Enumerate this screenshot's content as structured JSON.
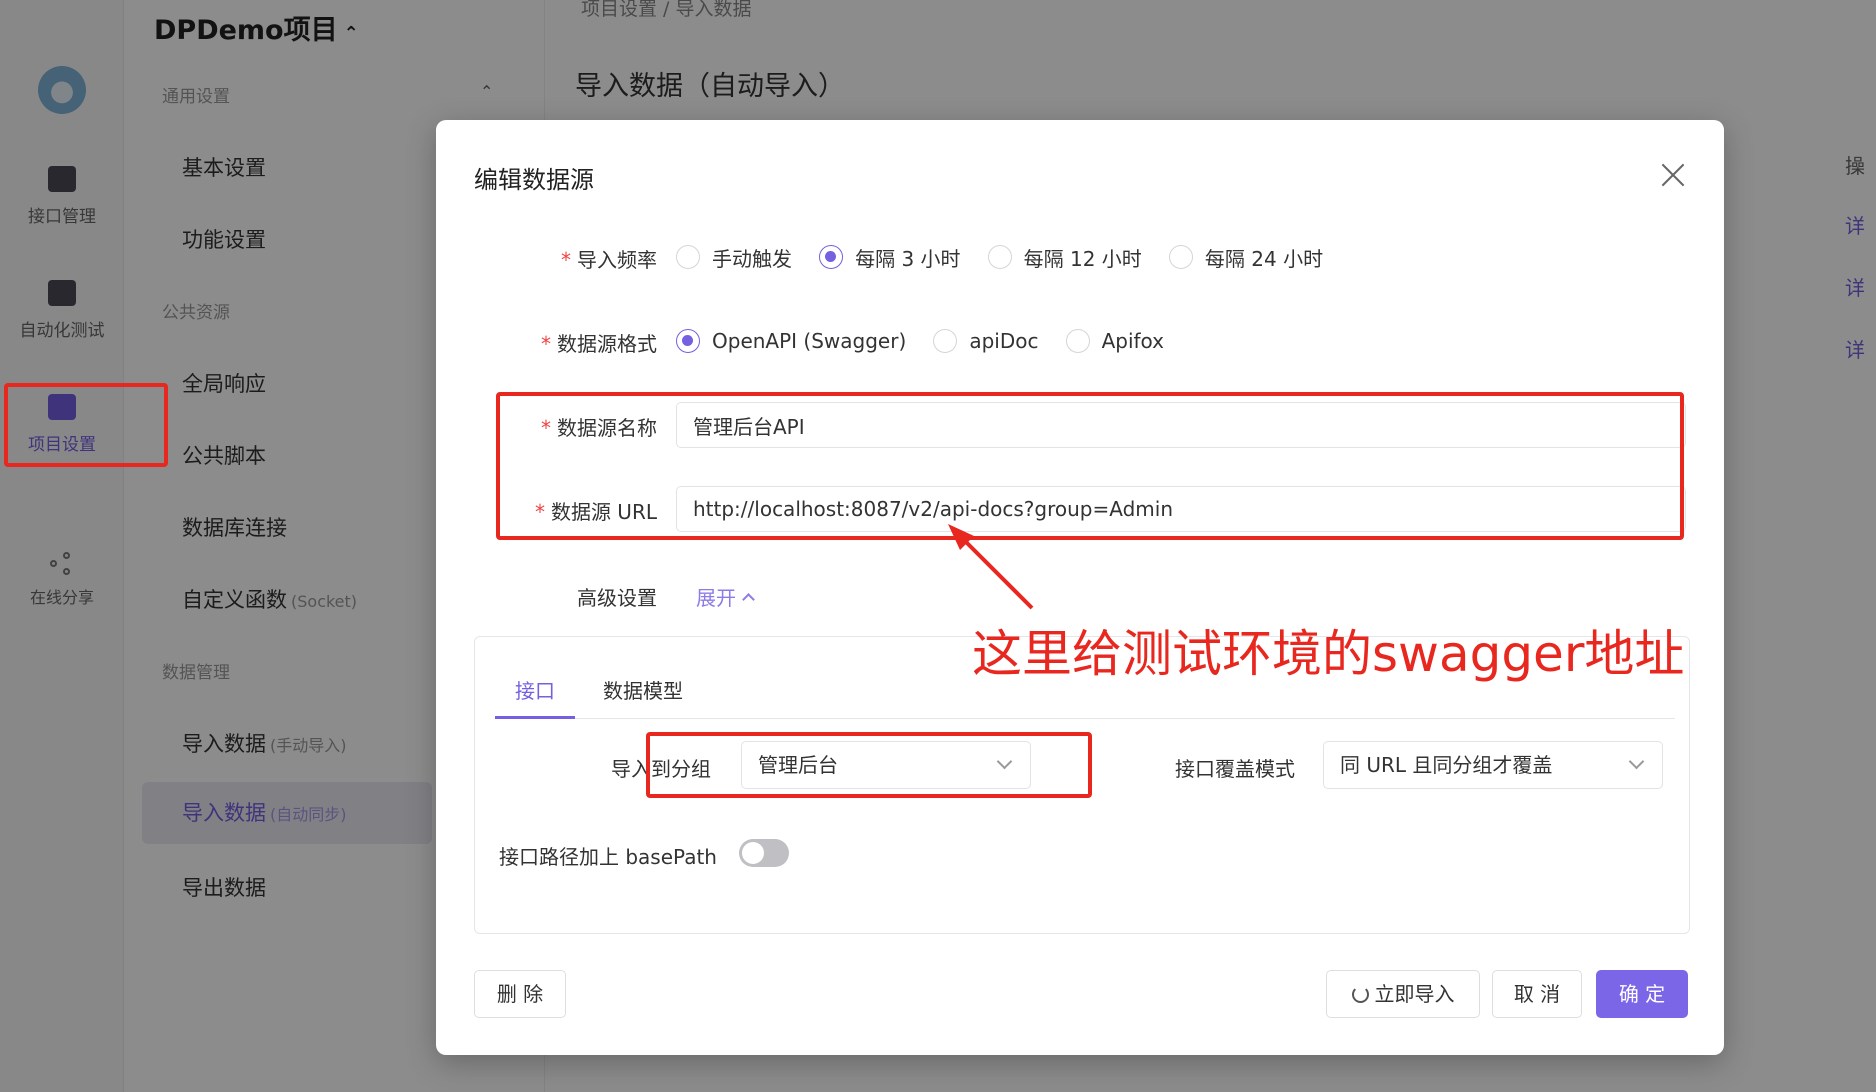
{
  "rail": {
    "items": [
      {
        "label": "接口管理",
        "icon": "api-icon"
      },
      {
        "label": "自动化测试",
        "icon": "automation-icon"
      },
      {
        "label": "项目设置",
        "icon": "project-settings-icon"
      },
      {
        "label": "在线分享",
        "icon": "share-icon"
      }
    ]
  },
  "sidebar": {
    "project_title": "DPDemo项目",
    "groups": [
      {
        "label": "通用设置"
      },
      {
        "label": "公共资源"
      },
      {
        "label": "数据管理"
      }
    ],
    "items": [
      {
        "label": "基本设置",
        "note": ""
      },
      {
        "label": "功能设置",
        "note": ""
      },
      {
        "label": "全局响应",
        "note": ""
      },
      {
        "label": "公共脚本",
        "note": ""
      },
      {
        "label": "数据库连接",
        "note": ""
      },
      {
        "label": "自定义函数",
        "note": "(Socket)"
      },
      {
        "label": "导入数据",
        "note": "(手动导入)"
      },
      {
        "label": "导入数据",
        "note": "(自动同步)"
      },
      {
        "label": "导出数据",
        "note": ""
      }
    ]
  },
  "main": {
    "breadcrumb": "项目设置 / 导入数据",
    "title": "导入数据（自动导入）",
    "right_cells": [
      "操",
      "详",
      "详",
      "详"
    ]
  },
  "modal": {
    "title": "编辑数据源",
    "frequency": {
      "label": "导入频率",
      "options": [
        "手动触发",
        "每隔 3 小时",
        "每隔 12 小时",
        "每隔 24 小时"
      ],
      "selected": "每隔 3 小时"
    },
    "format": {
      "label": "数据源格式",
      "options": [
        "OpenAPI (Swagger)",
        "apiDoc",
        "Apifox"
      ],
      "selected": "OpenAPI (Swagger)"
    },
    "name": {
      "label": "数据源名称",
      "value": "管理后台API"
    },
    "url": {
      "label": "数据源 URL",
      "value": "http://localhost:8087/v2/api-docs?group=Admin"
    },
    "advanced": {
      "label": "高级设置",
      "link": "展开"
    },
    "tabs": [
      "接口",
      "数据模型"
    ],
    "import_group": {
      "label": "导入到分组",
      "value": "管理后台"
    },
    "overwrite_mode": {
      "label": "接口覆盖模式",
      "value": "同 URL 且同分组才覆盖"
    },
    "basepath": {
      "label": "接口路径加上 basePath",
      "enabled": false
    },
    "buttons": {
      "delete": "删 除",
      "import_now": "立即导入",
      "cancel": "取 消",
      "ok": "确 定"
    }
  },
  "annotation": {
    "text": "这里给测试环境的swagger地址",
    "color": "#e8271f"
  },
  "colors": {
    "accent": "#7460e0",
    "required": "#e44444"
  }
}
